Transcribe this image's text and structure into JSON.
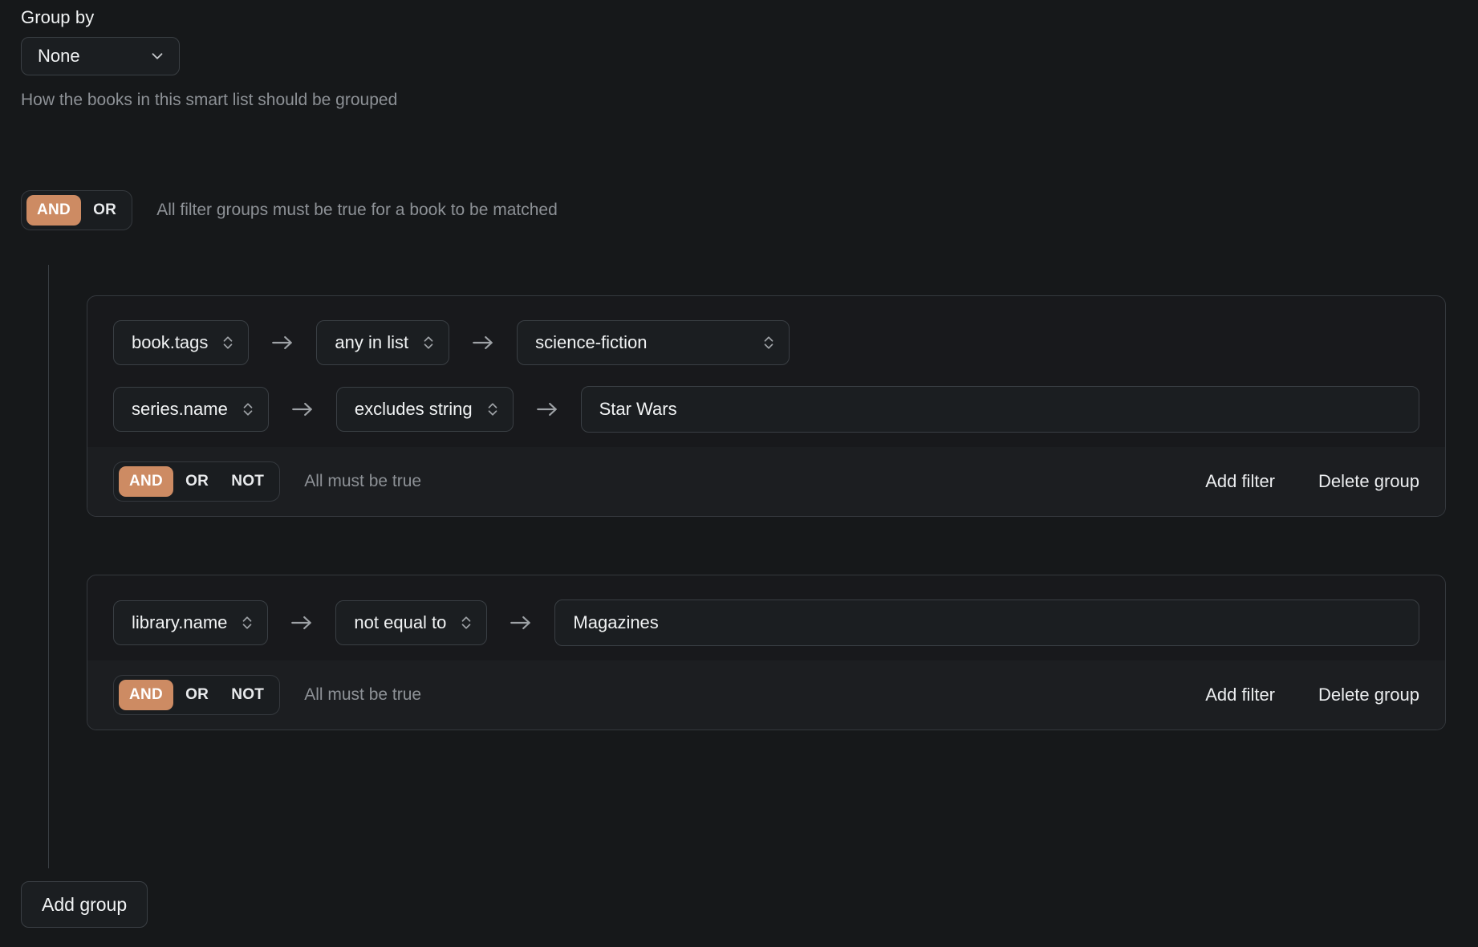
{
  "group_by": {
    "label": "Group by",
    "selected": "None",
    "help_text": "How the books in this smart list should be grouped",
    "chevron_icon": "chevron-down-icon"
  },
  "top_logic": {
    "options": [
      "AND",
      "OR"
    ],
    "selected": "AND",
    "description": "All filter groups must be true for a book to be matched"
  },
  "filter_groups": [
    {
      "rows": [
        {
          "field": "book.tags",
          "operator": "any in list",
          "value": "science-fiction",
          "value_kind": "select",
          "arrow_icon": "arrow-right-icon",
          "selector_icon": "chevron-up-down-icon"
        },
        {
          "field": "series.name",
          "operator": "excludes string",
          "value": "Star Wars",
          "value_kind": "text",
          "value_placeholder": "",
          "arrow_icon": "arrow-right-icon",
          "selector_icon": "chevron-up-down-icon"
        }
      ],
      "footer": {
        "options": [
          "AND",
          "OR",
          "NOT"
        ],
        "selected": "AND",
        "description": "All must be true",
        "add_filter_label": "Add filter",
        "delete_group_label": "Delete group"
      }
    },
    {
      "rows": [
        {
          "field": "library.name",
          "operator": "not equal to",
          "value": "Magazines",
          "value_kind": "text",
          "value_placeholder": "",
          "arrow_icon": "arrow-right-icon",
          "selector_icon": "chevron-up-down-icon"
        }
      ],
      "footer": {
        "options": [
          "AND",
          "OR",
          "NOT"
        ],
        "selected": "AND",
        "description": "All must be true",
        "add_filter_label": "Add filter",
        "delete_group_label": "Delete group"
      }
    }
  ],
  "add_group_label": "Add group",
  "colors": {
    "page_background": "#16181a",
    "card_background": "#18191c",
    "footer_background": "#1c1e21",
    "control_background": "#1b1e21",
    "border": "#3a3f44",
    "accent": "#cd8b63",
    "text_primary": "#f1f3f4",
    "text_muted": "#8d9196"
  }
}
